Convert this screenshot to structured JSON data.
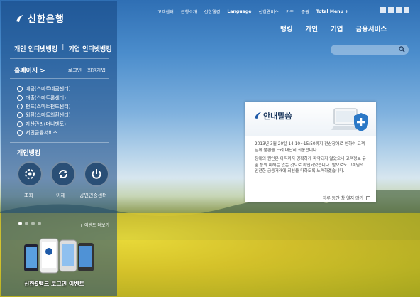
{
  "brand": {
    "name": "신한은행"
  },
  "top_links": [
    "고객센터",
    "은행소개",
    "신한웰컴",
    "Language",
    "신한웹비스",
    "카드",
    "증권",
    "Total Menu +"
  ],
  "main_nav": [
    "뱅킹",
    "개인",
    "기업",
    "금융서비스"
  ],
  "sidebar": {
    "internet_banking": [
      "개인 인터넷뱅킹",
      "기업 인터넷뱅킹"
    ],
    "home": "홈페이지 >",
    "login": "로그인",
    "signup": "회원가입",
    "menu": [
      "예금(스마트예금센터)",
      "대출(스마트론센터)",
      "펀드(스마트펀드센터)",
      "외환(스마트외환센터)",
      "자산관리(머니멘토)",
      "서민금융서비스"
    ],
    "personal_banking": "개인뱅킹",
    "pb_actions": [
      "조회",
      "이체",
      "공인인증센터"
    ],
    "event_more": "+ 이벤트 더보기",
    "promo": "신한S뱅크 로그인 이벤트"
  },
  "notice": {
    "title": "안내말씀",
    "paragraph1": "2013년 3월 20일 14:10~15:50까지 전산장애로 인하여 고객님께 불편을 드려 대단히 죄송합니다.",
    "paragraph2": "장애의 원인은 아직까지 명확하게 파악되지 않았으나 고객정보 유출 등의 피해는 없는 것으로 확인되었습니다. 앞으로도 고객님의 안전한 금융거래에 최선을 다하도록 노력하겠습니다.",
    "dont_show": "하루 동안 창 열지 않기"
  },
  "colors": {
    "brand_blue": "#1e5aa8",
    "sidebar_bg": "#14467f"
  }
}
